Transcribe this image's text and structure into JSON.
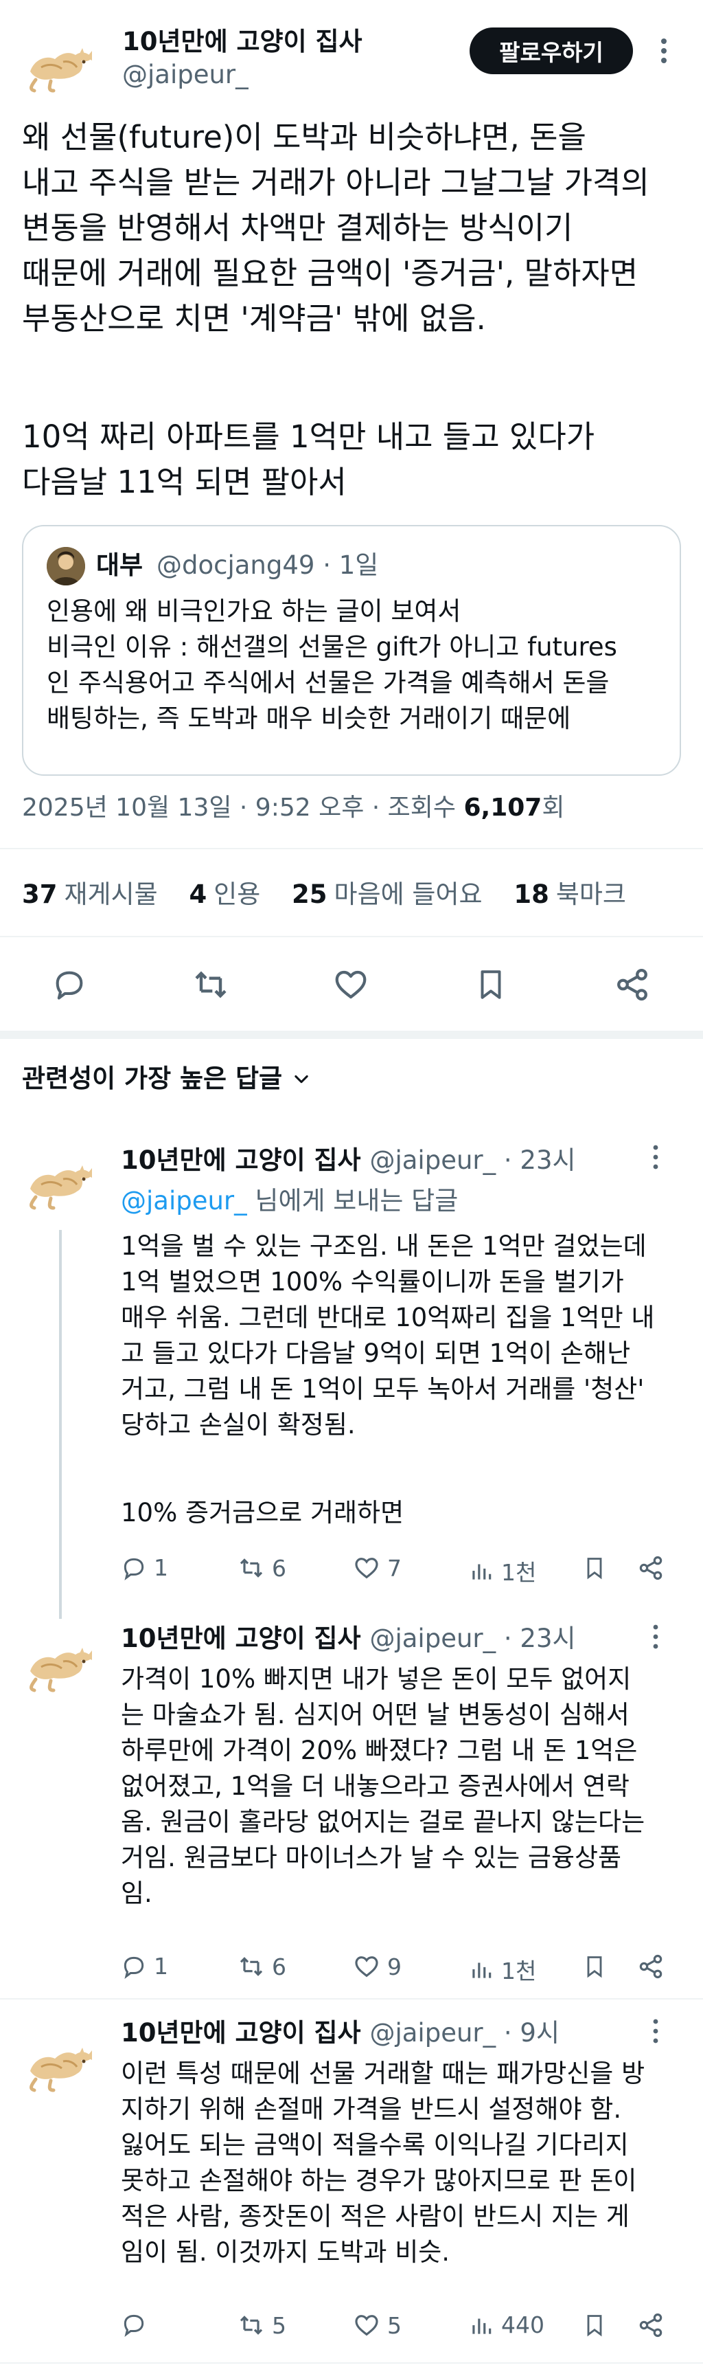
{
  "author": {
    "name": "10년만에 고양이 집사",
    "handle": "@jaipeur_",
    "follow_label": "팔로우하기"
  },
  "post": {
    "lines": [
      "왜 선물(future)이 도박과 비슷하냐면, 돈을",
      "내고 주식을 받는 거래가 아니라 그날그날 가격의",
      "변동을 반영해서 차액만 결제하는 방식이기",
      "때문에 거래에 필요한 금액이 '증거금', 말하자면",
      "부동산으로 치면 '계약금' 밖에 없음.",
      "",
      "10억 짜리 아파트를 1억만 내고 들고 있다가",
      "다음날 11억 되면 팔아서"
    ]
  },
  "quote": {
    "name": "대부",
    "handle_time": "@docjang49 · 1일",
    "lines": [
      "인용에 왜 비극인가요 하는 글이 보여서",
      "비극인 이유 : 해선갤의 선물은 gift가 아니고 futures",
      "인 주식용어고 주식에서 선물은 가격을 예측해서 돈을",
      "배팅하는, 즉 도박과 매우 비슷한 거래이기 때문에"
    ]
  },
  "meta": {
    "datetime": "2025년 10월 13일 · 9:52 오후 · 조회수 ",
    "views": "6,107",
    "views_suffix": "회"
  },
  "stats": {
    "retweets": "37",
    "retweets_label": "재게시물",
    "quotes": "4",
    "quotes_label": "인용",
    "likes": "25",
    "likes_label": "마음에 들어요",
    "bookmarks": "18",
    "bookmarks_label": "북마크"
  },
  "sort_label": "관련성이 가장 높은 답글",
  "replies": [
    {
      "name": "10년만에 고양이 집사",
      "handle_time": "@jaipeur_ · 23시",
      "reply_to_handle": "@jaipeur_",
      "reply_to_suffix": " 님에게 보내는 답글",
      "lines": [
        "1억을 벌 수 있는 구조임. 내 돈은 1억만 걸었는데",
        "1억 벌었으면 100% 수익률이니까 돈을 벌기가",
        "매우 쉬움. 그런데 반대로 10억짜리 집을 1억만 내",
        "고 들고 있다가 다음날 9억이 되면 1억이 손해난",
        "거고, 그럼 내 돈 1억이 모두 녹아서 거래를 '청산'",
        "당하고 손실이 확정됨.",
        "",
        "10% 증거금으로 거래하면"
      ],
      "replies": "1",
      "retweets": "6",
      "likes": "7",
      "views": "1천"
    },
    {
      "name": "10년만에 고양이 집사",
      "handle_time": "@jaipeur_ · 23시",
      "lines": [
        "가격이 10% 빠지면 내가 넣은 돈이 모두 없어지",
        "는 마술쇼가 됨. 심지어 어떤 날 변동성이 심해서",
        "하루만에 가격이 20% 빠졌다? 그럼 내 돈 1억은",
        "없어졌고, 1억을 더 내놓으라고 증권사에서 연락",
        "옴. 원금이 홀라당 없어지는 걸로 끝나지 않는다는",
        "거임. 원금보다 마이너스가 날 수 있는 금융상품",
        "임."
      ],
      "replies": "1",
      "retweets": "6",
      "likes": "9",
      "views": "1천"
    },
    {
      "name": "10년만에 고양이 집사",
      "handle_time": "@jaipeur_ · 9시",
      "lines": [
        "이런 특성 때문에 선물 거래할 때는 패가망신을 방",
        "지하기 위해 손절매 가격을 반드시 설정해야 함.",
        "잃어도 되는 금액이 적을수록 이익나길 기다리지",
        "못하고 손절해야 하는 경우가 많아지므로 판 돈이",
        "적은 사람, 종잣돈이 적은 사람이 반드시 지는 게",
        "임이 됨. 이것까지 도박과 비슷."
      ],
      "replies": "",
      "retweets": "5",
      "likes": "5",
      "views": "440"
    }
  ]
}
